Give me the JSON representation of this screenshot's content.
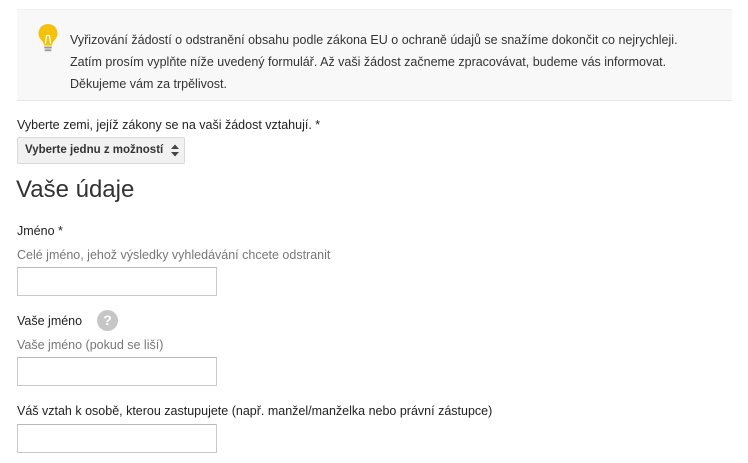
{
  "notice": {
    "icon": "lightbulb-icon",
    "icon_color": "#f4c20d",
    "lines": [
      "Vyřizování žádostí o odstranění obsahu podle zákona EU o ochraně údajů se snažíme dokončit co nejrychleji.",
      "Zatím prosím vyplňte níže uvedený formulář. Až vaši žádost začneme zpracovávat, budeme vás informovat.",
      "Děkujeme vám za trpělivost."
    ]
  },
  "country": {
    "label": "Vyberte zemi, jejíž zákony se na vaši žádost vztahují. *",
    "select_value": "Vyberte jednu z možností"
  },
  "section": {
    "title": "Vaše údaje"
  },
  "fields": {
    "full_name": {
      "label": "Jméno *",
      "hint": "Celé jméno, jehož výsledky vyhledávání chcete odstranit",
      "value": ""
    },
    "your_name": {
      "label": "Vaše jméno",
      "help_icon": "question-mark-icon",
      "help_symbol": "?",
      "hint": "Vaše jméno (pokud se liší)",
      "value": ""
    },
    "relationship": {
      "label": "Váš vztah k osobě, kterou zastupujete (např. manžel/manželka nebo právní zástupce)",
      "value": ""
    }
  }
}
